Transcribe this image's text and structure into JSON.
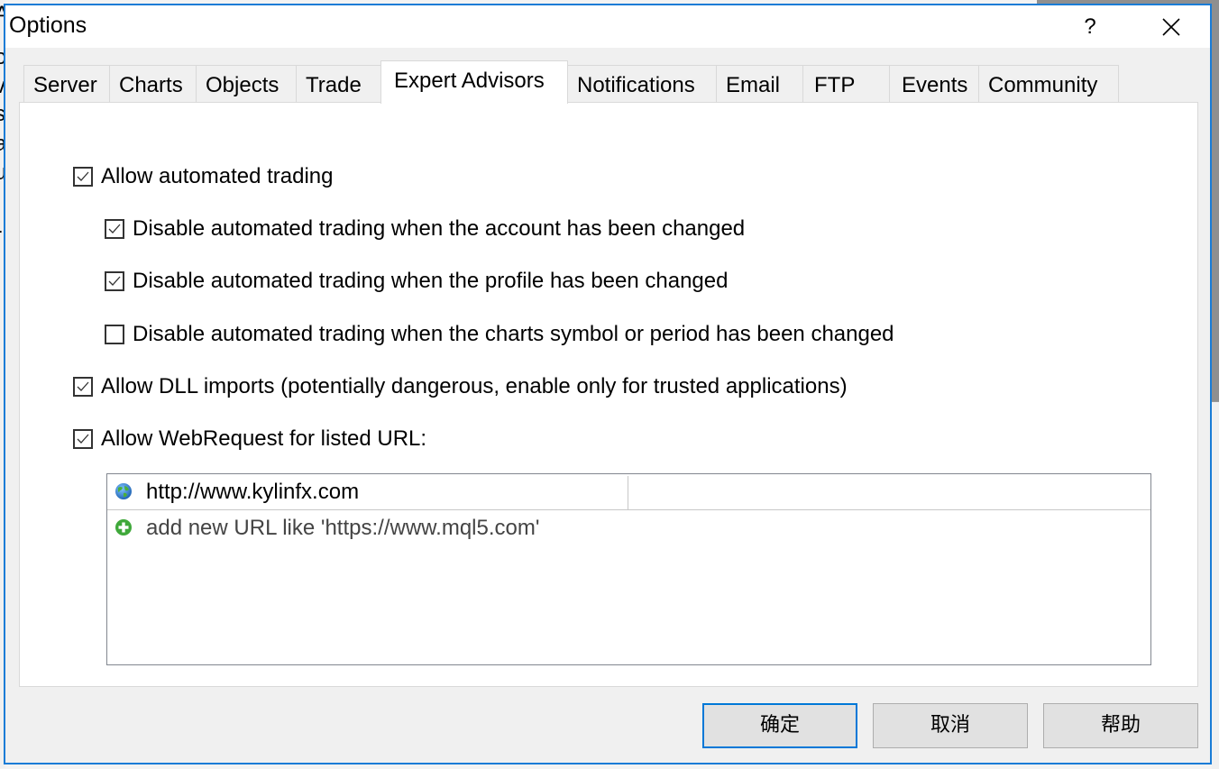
{
  "background": {
    "left_edge_glyphs": [
      "A",
      "o",
      "v",
      "s",
      "a",
      "u",
      "r"
    ]
  },
  "dialog": {
    "title": "Options",
    "help_label": "?",
    "close_label": "✕"
  },
  "tabs": [
    {
      "label": "Server",
      "active": false
    },
    {
      "label": "Charts",
      "active": false
    },
    {
      "label": "Objects",
      "active": false
    },
    {
      "label": "Trade",
      "active": false
    },
    {
      "label": "Expert Advisors",
      "active": true
    },
    {
      "label": "Notifications",
      "active": false
    },
    {
      "label": "Email",
      "active": false
    },
    {
      "label": "FTP",
      "active": false
    },
    {
      "label": "Events",
      "active": false
    },
    {
      "label": "Community",
      "active": false
    }
  ],
  "options": [
    {
      "label": "Allow automated trading",
      "checked": true
    },
    {
      "label": "Disable automated trading when the account has been changed",
      "checked": true
    },
    {
      "label": "Disable automated trading when the profile has been changed",
      "checked": true
    },
    {
      "label": "Disable automated trading when the charts symbol or period has been changed",
      "checked": false
    },
    {
      "label": "Allow DLL imports (potentially dangerous, enable only for trusted applications)",
      "checked": true
    },
    {
      "label": "Allow WebRequest for listed URL:",
      "checked": true
    }
  ],
  "url_list": {
    "items": [
      {
        "icon": "globe-icon",
        "url": "http://www.kylinfx.com"
      }
    ],
    "add_hint": "add new URL like 'https://www.mql5.com'"
  },
  "buttons": {
    "ok": "确定",
    "cancel": "取消",
    "help": "帮助"
  },
  "colors": {
    "accent": "#1a7cd6",
    "default_button_border": "#0078d7"
  }
}
